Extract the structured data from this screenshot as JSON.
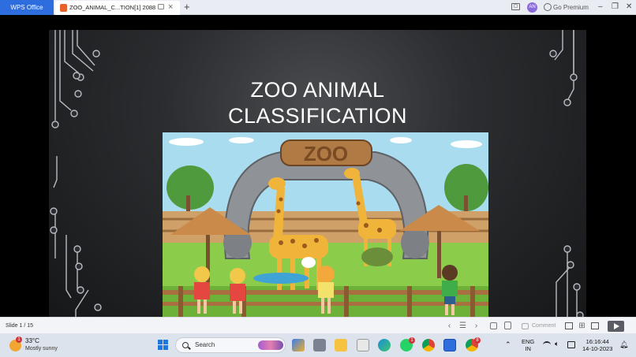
{
  "titlebar": {
    "app_tab_label": "WPS Office",
    "doc_tab_label": "ZOO_ANIMAL_C...TION[1] 2088",
    "new_tab_label": "+",
    "avatar_initials": "AN",
    "premium_label": "Go Premium",
    "minimize_label": "–",
    "restore_label": "❐",
    "close_label": "✕"
  },
  "slide": {
    "title_line1": "ZOO ANIMAL",
    "title_line2": "CLASSIFICATION",
    "sign_text": "ZOO"
  },
  "statusbar": {
    "slide_indicator": "Slide 1 / 15",
    "comment_label": "Comment"
  },
  "taskbar": {
    "weather_temp": "33°C",
    "weather_desc": "Mostly sunny",
    "weather_badge": "1",
    "search_label": "Search",
    "whatsapp_badge": "1",
    "chrome_badge": "8",
    "language_line1": "ENG",
    "language_line2": "IN",
    "time": "16:16:44",
    "date": "14-10-2023"
  },
  "colors": {
    "wps_blue": "#2e6dde",
    "slide_bg": "#2c2d30",
    "sky": "#a9dcee",
    "grass": "#8ccc4b"
  },
  "icons": [
    "ppt-file-icon",
    "monitor-icon",
    "close-icon",
    "plus-icon",
    "window-icon",
    "avatar",
    "go-premium-icon",
    "prev-icon",
    "list-icon",
    "next-icon",
    "fit-icon",
    "export-icon",
    "comment-icon",
    "normal-view-icon",
    "grid-view-icon",
    "reading-view-icon",
    "play-icon",
    "windows-start-icon",
    "search-icon",
    "wifi-icon",
    "volume-icon",
    "battery-icon",
    "bell-icon"
  ]
}
